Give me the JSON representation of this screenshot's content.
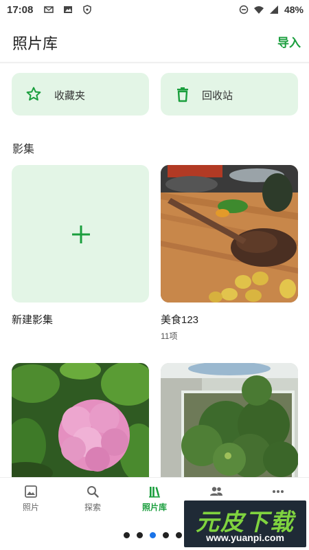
{
  "status_bar": {
    "time": "17:08",
    "battery": "48%"
  },
  "header": {
    "title": "照片库",
    "import_label": "导入"
  },
  "quick_actions": [
    {
      "label": "收藏夹",
      "icon": "star-icon"
    },
    {
      "label": "回收站",
      "icon": "trash-icon"
    }
  ],
  "albums_section": {
    "title": "影集"
  },
  "albums": [
    {
      "name": "新建影集",
      "count": "",
      "icon": "plus-icon"
    },
    {
      "name": "美食123",
      "count": "11项"
    }
  ],
  "bottom_nav": {
    "items": [
      {
        "label": "照片",
        "icon": "photo-icon",
        "active": false
      },
      {
        "label": "探索",
        "icon": "search-icon",
        "active": false
      },
      {
        "label": "照片库",
        "icon": "library-icon",
        "active": true
      },
      {
        "label": "",
        "icon": "people-icon",
        "active": false
      },
      {
        "label": "",
        "icon": "more-icon",
        "active": false
      }
    ]
  },
  "page_indicator": {
    "count": 5,
    "active_index": 2
  },
  "watermark": {
    "title": "元皮下载",
    "url": "www.yuanpi.com"
  },
  "colors": {
    "accent": "#1a9e3d",
    "card_bg": "#e3f5e6"
  }
}
